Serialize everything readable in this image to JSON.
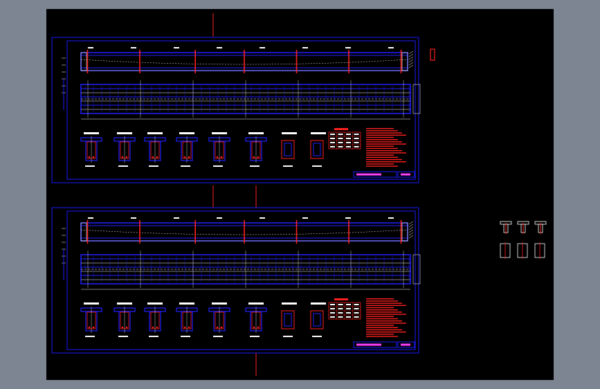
{
  "app": {
    "canvas_bg": "#000000",
    "frame_bg": "#7d8492"
  },
  "colors": {
    "frame": "#1a1aff",
    "beam": "#2020ff",
    "accent": "#ff2020",
    "white": "#ffffff",
    "magenta": "#ff40ff",
    "cyan": "#40ffff"
  },
  "sheets": [
    {
      "id": "sheet-1",
      "title_block": "",
      "sheet_no": ""
    },
    {
      "id": "sheet-2",
      "title_block": "",
      "sheet_no": ""
    }
  ],
  "side_details": [
    {
      "id": "top-sections",
      "count": 3
    },
    {
      "id": "bottom-sections",
      "count": 3
    }
  ]
}
